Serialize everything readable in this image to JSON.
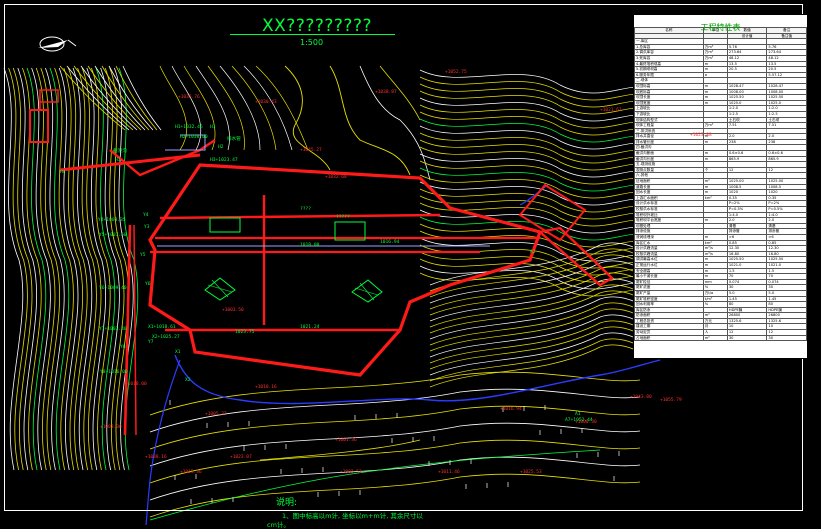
{
  "title": "XX?????????",
  "scale": "1:500",
  "table": {
    "title": "工程特性表",
    "columns": [
      "名称",
      "单位",
      "数值",
      "备注"
    ],
    "subheader": [
      "",
      "",
      "设计值",
      "备注值"
    ],
    "rows": [
      [
        "一.库区",
        "",
        "",
        ""
      ],
      [
        "1.总库容",
        "万m³",
        "5.76",
        "5.76"
      ],
      [
        "2.调洪库容",
        "万m³",
        "273.64",
        "273.64"
      ],
      [
        "3.死库容",
        "万m³",
        "48.12",
        "48.12"
      ],
      [
        "4.最终堆积坝高",
        "m",
        "13.5",
        "13.5"
      ],
      [
        "5.初期坝坝高",
        "m",
        "20.5",
        "20.5"
      ],
      [
        "6.服务年限",
        "a",
        "",
        "5.57.12"
      ],
      [
        "二.坝体",
        "",
        "",
        ""
      ],
      [
        "坝顶标高",
        "m",
        "1028.47",
        "1028.47"
      ],
      [
        "坝底标高",
        "m",
        "1008.00",
        "1008.00"
      ],
      [
        "坝顶长度",
        "m",
        "1025.50",
        "1025.50"
      ],
      [
        "坝顶宽度",
        "m",
        "1025.0",
        "1025.0"
      ],
      [
        "上游坡比",
        "",
        "1:2.0",
        "1:2.0"
      ],
      [
        "下游坡比",
        "",
        "1:2.5",
        "1:2.5"
      ],
      [
        "坝体结构型式",
        "",
        "土石坝",
        "土石坝"
      ],
      [
        "坝体工程量",
        "万m³",
        "7.51",
        "7.51"
      ],
      [
        "三.排洪系统",
        "",
        "",
        ""
      ],
      [
        "排水井直径",
        "m",
        "2.0",
        "2.0"
      ],
      [
        "排水管长度",
        "m",
        "238",
        "238"
      ],
      [
        "四.截洪沟",
        "",
        "",
        ""
      ],
      [
        "截洪沟断面",
        "m",
        "0.6×0.6",
        "0.6×0.6"
      ],
      [
        "截洪沟长度",
        "m",
        "865.9",
        "865.9"
      ],
      [
        "五.观测设施",
        "",
        "",
        ""
      ],
      [
        "观测点数量",
        "个",
        "12",
        "12"
      ],
      [
        "六.其他",
        "",
        "",
        ""
      ],
      [
        "征地面积",
        "m²",
        "1025.00",
        "1025.00"
      ],
      [
        "道路长度",
        "m",
        "1008.5",
        "1008.5"
      ],
      [
        "回水长度",
        "m",
        "1020",
        "1020"
      ],
      [
        "上游汇水面积",
        "km²",
        "0.35",
        "0.35"
      ],
      [
        "设计洪水标准",
        "",
        "P=2%",
        "P=2%"
      ],
      [
        "校核洪水标准",
        "",
        "P=0.5%",
        "P=0.5%"
      ],
      [
        "堆积坝外坡比",
        "",
        "1:4.0",
        "1:4.0"
      ],
      [
        "堆积坝平台宽度",
        "m",
        "2.0",
        "2.0"
      ],
      [
        "坝基处理",
        "",
        "清基",
        "清基"
      ],
      [
        "排渗设施",
        "",
        "排渗管",
        "排渗管"
      ],
      [
        "浸润线埋深",
        "m",
        ">6",
        ">6"
      ],
      [
        "库区汇水",
        "km²",
        "0.85",
        "0.85"
      ],
      [
        "设计洪峰流量",
        "m³/s",
        "12.30",
        "12.30"
      ],
      [
        "校核洪峰流量",
        "m³/s",
        "16.80",
        "16.80"
      ],
      [
        "调洪最高水位",
        "m",
        "1025.50",
        "1025.50"
      ],
      [
        "正常运行水位",
        "m",
        "1021.0",
        "1021.0"
      ],
      [
        "安全超高",
        "m",
        "1.5",
        "1.5"
      ],
      [
        "最小干滩长度",
        "m",
        "70",
        "70"
      ],
      [
        "尾矿粒径",
        "mm",
        "0.074",
        "0.074"
      ],
      [
        "尾矿浓度",
        "%",
        "30",
        "30"
      ],
      [
        "尾矿产量",
        "万t/a",
        "5.0",
        "5.0"
      ],
      [
        "尾矿堆积密度",
        "t/m³",
        "1.45",
        "1.45"
      ],
      [
        "回水利用率",
        "%",
        "80",
        "80"
      ],
      [
        "库区防渗",
        "",
        "HDPE膜",
        "HDPE膜"
      ],
      [
        "防渗面积",
        "m²",
        "26800",
        "26800"
      ],
      [
        "工程总投资",
        "万元",
        "1325.6",
        "1325.6"
      ],
      [
        "建设工期",
        "月",
        "10",
        "10"
      ],
      [
        "劳动定员",
        "人",
        "12",
        "12"
      ],
      [
        "占地面积",
        "m²",
        "30",
        "30"
      ]
    ]
  },
  "labels": {
    "elevations": [
      "+1030.43",
      "+1035.76",
      "+1045.27",
      "+1032.68",
      "+1038.87",
      "+1052.75",
      "+1021.61",
      "+1023.88",
      "+1003.50",
      "+1018.00",
      "+1005.37",
      "+1010.16",
      "+1003.36",
      "+1038.16",
      "+1015.36",
      "+1023.07",
      "+1016.94",
      "+1000.30",
      "+1025.53",
      "+1011.46",
      "+1001.36",
      "+1003.53",
      "+1043.80",
      "+1055.79"
    ],
    "survey": [
      "Y4",
      "Y5",
      "Y6",
      "Y7",
      "Y3",
      "Y8",
      "H1",
      "H2",
      "H3",
      "H4",
      "X1",
      "X2",
      "A1",
      "A2"
    ],
    "coords": [
      "Y4+1003.35",
      "Y5+1007.50",
      "Y6+1009.40",
      "Y7+1003.40",
      "Y8+1016.00",
      "H1+1032.46",
      "H2+1038.00",
      "H3+1023.47",
      "X1+1018.61",
      "X2+1025.27",
      "A7+1052.44"
    ],
    "bars": [
      "1018.00",
      "1023.75",
      "1021.24",
      "1016.94"
    ],
    "trench": "截洪沟",
    "drain": "排水管",
    "pond1": "????",
    "pond2": "?????"
  },
  "notes": {
    "title": "说明:",
    "line1": "1、图中标高以m计, 坐标以m+m计, 其余尺寸以",
    "unit": "cm计。"
  },
  "colors": {
    "contour_yellow": "#e8e000",
    "contour_white": "#ffffff",
    "dam_red": "#ff1a1a",
    "green": "#00ff3c",
    "river_blue": "#2a3cff",
    "cyan": "#00c8ff"
  }
}
